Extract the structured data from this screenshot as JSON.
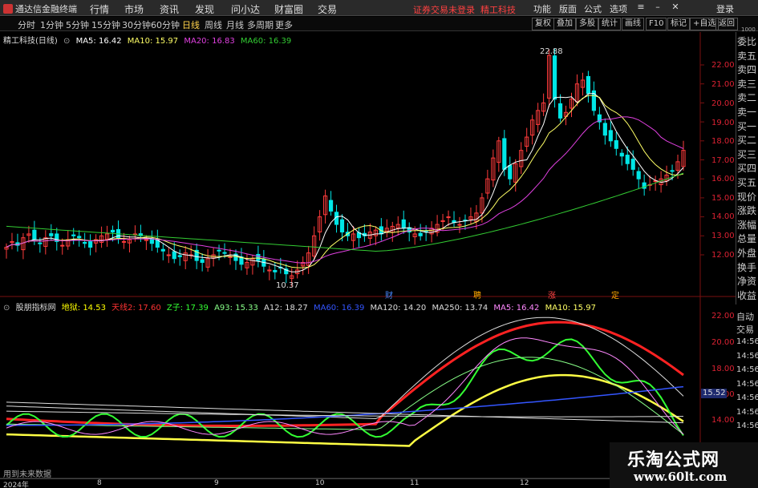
{
  "titlebar": {
    "app_name": "通达信金融终端",
    "menus": [
      "行情",
      "市场",
      "资讯",
      "发现",
      "问小达",
      "财富圈",
      "交易"
    ],
    "warning": "证券交易未登录",
    "stock_name": "精工科技",
    "tools": [
      "功能",
      "版面",
      "公式",
      "选项"
    ],
    "login": "登录"
  },
  "toolbar": {
    "periods": [
      "分时",
      "1分钟",
      "5分钟",
      "15分钟",
      "30分钟",
      "60分钟",
      "日线",
      "周线",
      "月线",
      "多周期",
      "更多"
    ],
    "active_period": "日线",
    "right_buttons": [
      "复权",
      "叠加",
      "多股",
      "统计",
      "画线",
      "F10",
      "标记",
      "+自选",
      "返回"
    ]
  },
  "main_legend": {
    "title": "精工科技(日线)",
    "ma5": "MA5: 16.42",
    "ma10": "MA10: 15.97",
    "ma20": "MA20: 16.83",
    "ma60": "MA60: 16.39"
  },
  "main_chart": {
    "high_label": "22.88",
    "low_label": "10.37",
    "price_ticks": [
      "22.00",
      "21.00",
      "20.00",
      "19.00",
      "18.00",
      "17.00",
      "16.00",
      "15.00",
      "14.00",
      "13.00",
      "12.00"
    ],
    "event_markers": [
      "财",
      "聘",
      "涨",
      "定"
    ]
  },
  "right_panel": {
    "items": [
      "委比",
      "卖五",
      "卖四",
      "卖三",
      "卖二",
      "卖一",
      "买一",
      "买二",
      "买三",
      "买四",
      "买五",
      "现价",
      "涨跌",
      "涨幅",
      "总量",
      "外盘",
      "换手",
      "净资",
      "收益"
    ],
    "items2": [
      "自动",
      "交易"
    ],
    "top_small": "1000"
  },
  "indicator_legend": {
    "name": "股朋指标网",
    "dizhu": "地狱: 14.53",
    "tianxian": "天线2: 17.60",
    "zizi": "Z子: 17.39",
    "a93": "A93: 15.33",
    "a12": "A12: 18.27",
    "ma60": "MA60: 16.39",
    "ma120": "MA120: 14.20",
    "ma250": "MA250: 13.74",
    "ma5": "MA5: 16.42",
    "ma10": "MA10: 15.97"
  },
  "indicator_chart": {
    "ticks": [
      "22.00",
      "20.00",
      "18.00",
      "16.00",
      "14.00"
    ],
    "right_labels": [
      "14:56",
      "14:56",
      "14:56",
      "14:56",
      "14:56",
      "14:56",
      "14:56"
    ],
    "current_value": "15.52",
    "footnote": "用到未来数据"
  },
  "dates": [
    "2024年",
    "8",
    "9",
    "10",
    "11",
    "12"
  ],
  "watermark": {
    "cn": "乐淘公式网",
    "url": "www.60lt.com"
  },
  "colors": {
    "up": "#ff3b3b",
    "down": "#00e6e6",
    "ma5": "#ffffff",
    "ma10": "#ffff66",
    "ma20": "#e040e0",
    "ma60": "#33cc33"
  },
  "chart_data": {
    "type": "candlestick",
    "title": "精工科技(日线)",
    "period": "日线",
    "ylim": [
      10,
      23
    ],
    "high": 22.88,
    "low": 10.37,
    "ma_values": {
      "MA5": 16.42,
      "MA10": 15.97,
      "MA20": 16.83,
      "MA60": 16.39
    },
    "x_labels": [
      "2024年",
      "8",
      "9",
      "10",
      "11",
      "12"
    ]
  }
}
